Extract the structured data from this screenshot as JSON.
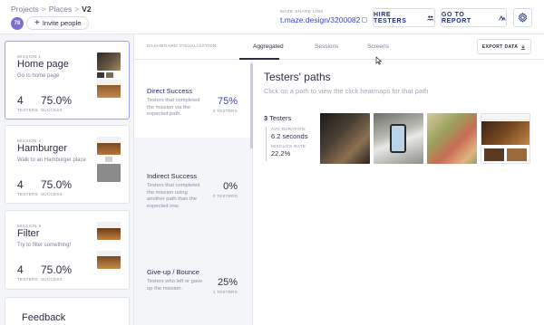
{
  "header": {
    "breadcrumb": [
      "Projects",
      "Places",
      "V2"
    ],
    "breadcrumb_sep": ">",
    "avatar_initials": "78",
    "invite_label": "Invite people",
    "share_label": "MAZE SHARE LINK",
    "share_link": "t.maze.design/3200082",
    "hire_label": "HIRE TESTERS",
    "report_label": "GO TO REPORT",
    "accent": "#1f2a7a"
  },
  "sidebar": {
    "missions": [
      {
        "num": "MISSION 1",
        "title": "Home page",
        "desc": "Go to home page",
        "testers": "4",
        "testers_label": "TESTERS",
        "success": "75.0%",
        "success_label": "SUCCESS",
        "active": true
      },
      {
        "num": "MISSION 2",
        "title": "Hamburger",
        "desc": "Walk to an Hamburger place",
        "testers": "4",
        "testers_label": "TESTERS",
        "success": "75.0%",
        "success_label": "SUCCESS",
        "active": false
      },
      {
        "num": "MISSION 3",
        "title": "Filter",
        "desc": "Try to filter something!",
        "testers": "4",
        "testers_label": "TESTERS",
        "success": "75.0%",
        "success_label": "SUCCESS",
        "active": false
      }
    ],
    "feedback_title": "Feedback"
  },
  "tabs": {
    "section_label": "DASHBOARD VISUALISATION",
    "items": [
      "Aggregated",
      "Sessions",
      "Screens"
    ],
    "active": "Aggregated",
    "export_label": "EXPORT DATA"
  },
  "outcomes": [
    {
      "title": "Direct Success",
      "desc": "Testers that completed the mission via the expected path.",
      "pct": "75%",
      "count": "3 TESTERS",
      "color": "#3b45c4"
    },
    {
      "title": "Indirect Success",
      "desc": "Testers that completed the mission using another path than the expected one.",
      "pct": "0%",
      "count": "0 TESTERS",
      "color": "#2b2d42"
    },
    {
      "title": "Give-up / Bounce",
      "desc": "Testers who left or gave up the mission.",
      "pct": "25%",
      "count": "1 TESTERS",
      "color": "#2b2d42"
    }
  ],
  "paths": {
    "title": "Testers' paths",
    "subtitle": "Click on a path to view the click heatmaps for that path",
    "testers_count": "3",
    "testers_word": "Testers",
    "avg_duration_label": "AVG DURATION:",
    "avg_duration": "6.2 seconds",
    "misclick_label": "MISCLICK RATE:",
    "misclick": "22.2%"
  }
}
